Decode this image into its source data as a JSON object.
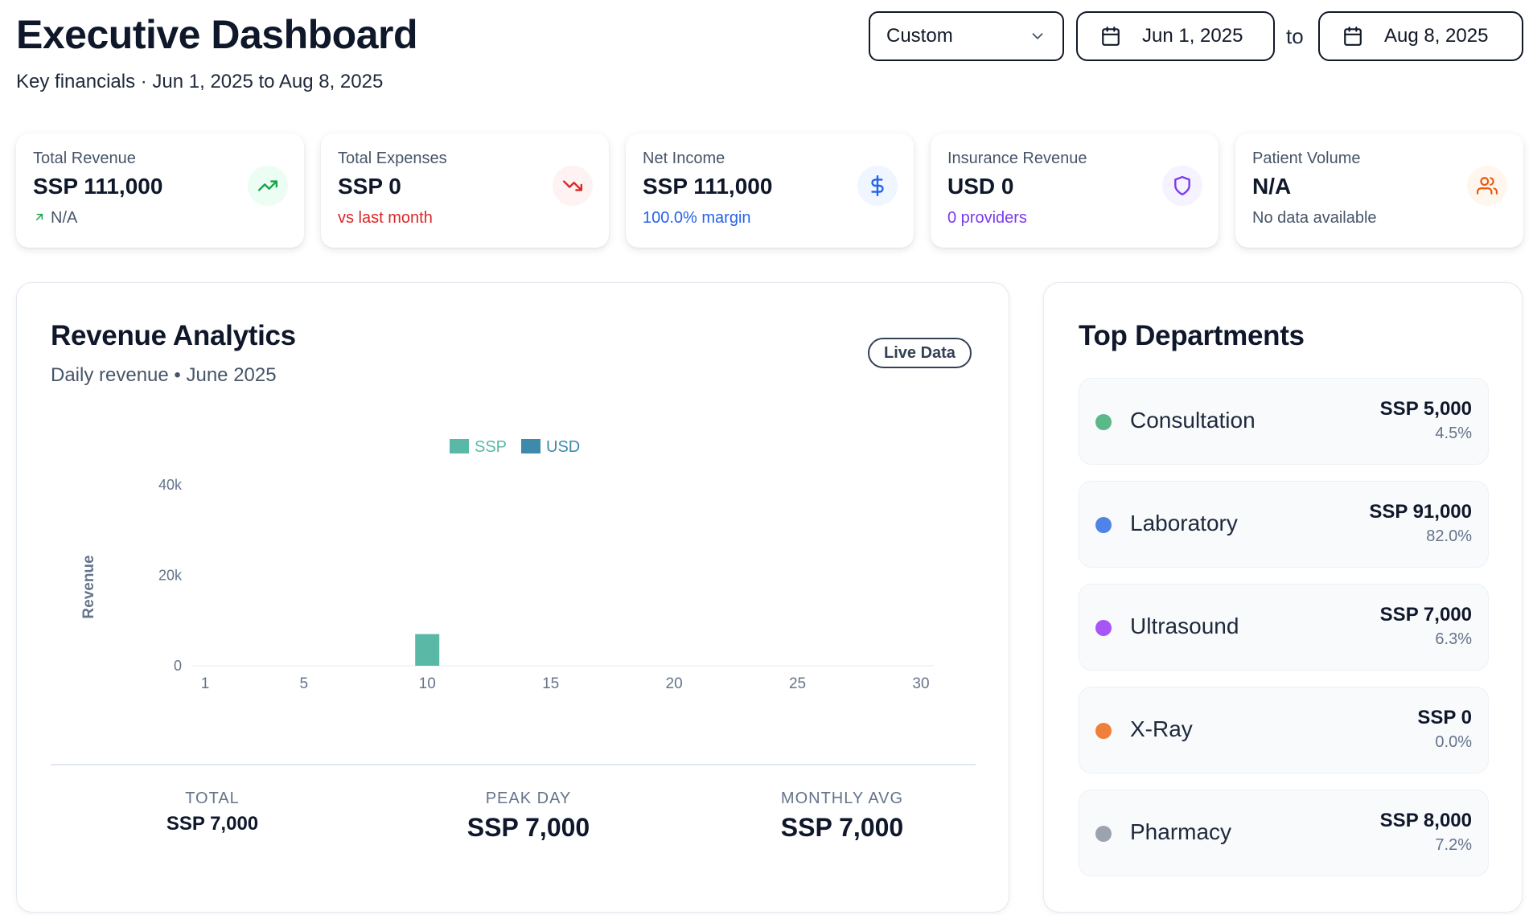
{
  "header": {
    "title": "Executive Dashboard",
    "subtitle": "Key financials · Jun 1, 2025 to Aug 8, 2025",
    "range_select": "Custom",
    "date_start": "Jun 1, 2025",
    "to_label": "to",
    "date_end": "Aug 8, 2025"
  },
  "kpis": [
    {
      "label": "Total Revenue",
      "value": "SSP 111,000",
      "sub": "N/A",
      "sub_color": "#475569",
      "icon": "trending-up-icon",
      "icon_color": "#16a34a",
      "icon_bg": "#ecfdf3"
    },
    {
      "label": "Total Expenses",
      "value": "SSP 0",
      "sub": "vs last month",
      "sub_color": "#dc2626",
      "icon": "trending-down-icon",
      "icon_color": "#dc2626",
      "icon_bg": "#fef2f2"
    },
    {
      "label": "Net Income",
      "value": "SSP 111,000",
      "sub": "100.0% margin",
      "sub_color": "#2563eb",
      "icon": "dollar-icon",
      "icon_color": "#2563eb",
      "icon_bg": "#eff6ff"
    },
    {
      "label": "Insurance Revenue",
      "value": "USD 0",
      "sub": "0 providers",
      "sub_color": "#7c3aed",
      "icon": "shield-icon",
      "icon_color": "#7c3aed",
      "icon_bg": "#f5f3ff"
    },
    {
      "label": "Patient Volume",
      "value": "N/A",
      "sub": "No data available",
      "sub_color": "#475569",
      "icon": "users-icon",
      "icon_color": "#ea580c",
      "icon_bg": "#fff7ed"
    }
  ],
  "revenue": {
    "title": "Revenue Analytics",
    "subtitle": "Daily revenue • June 2025",
    "badge": "Live Data"
  },
  "chart_data": {
    "type": "bar",
    "ylabel": "Revenue",
    "xlabel": "",
    "ylim": [
      0,
      40000
    ],
    "yticks": [
      {
        "v": 0,
        "label": "0"
      },
      {
        "v": 20000,
        "label": "20k"
      },
      {
        "v": 40000,
        "label": "40k"
      }
    ],
    "xlim": [
      1,
      30
    ],
    "xticks": [
      1,
      5,
      10,
      15,
      20,
      25,
      30
    ],
    "legend_position": "top-center",
    "grid": false,
    "series": [
      {
        "name": "SSP",
        "color": "#5ab8a6",
        "points": [
          {
            "x": 10,
            "y": 7000
          }
        ]
      },
      {
        "name": "USD",
        "color": "#3d8aaa",
        "points": []
      }
    ]
  },
  "stats": [
    {
      "label": "TOTAL",
      "value": "SSP 7,000"
    },
    {
      "label": "PEAK DAY",
      "value": "SSP 7,000"
    },
    {
      "label": "MONTHLY AVG",
      "value": "SSP 7,000"
    }
  ],
  "departments": {
    "title": "Top Departments",
    "items": [
      {
        "name": "Consultation",
        "amount": "SSP 5,000",
        "percent": "4.5%",
        "color": "#5bb889"
      },
      {
        "name": "Laboratory",
        "amount": "SSP 91,000",
        "percent": "82.0%",
        "color": "#4f83e8"
      },
      {
        "name": "Ultrasound",
        "amount": "SSP 7,000",
        "percent": "6.3%",
        "color": "#a855f7"
      },
      {
        "name": "X-Ray",
        "amount": "SSP 0",
        "percent": "0.0%",
        "color": "#ef7f3a"
      },
      {
        "name": "Pharmacy",
        "amount": "SSP 8,000",
        "percent": "7.2%",
        "color": "#9ca3af"
      }
    ]
  }
}
